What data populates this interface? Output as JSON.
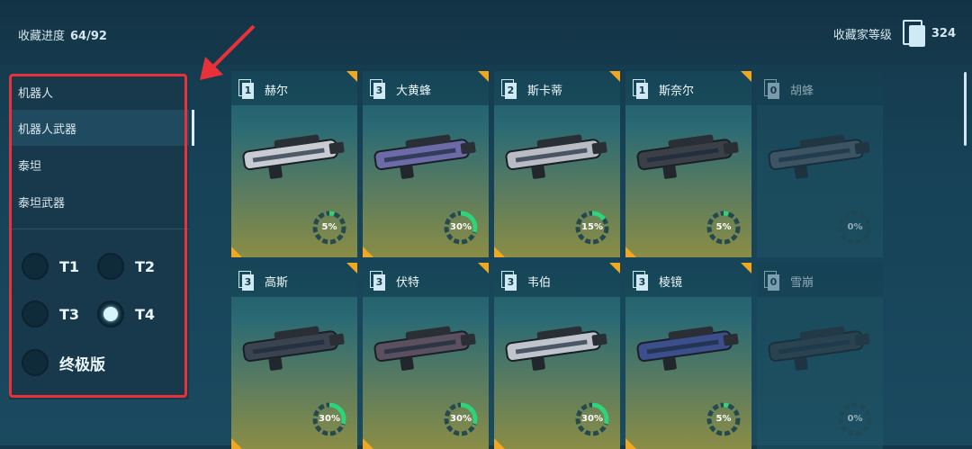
{
  "header": {
    "progress_label": "收藏进度",
    "progress_value": "64/92",
    "level_label": "收藏家等级",
    "level_value": "324"
  },
  "sidebar": {
    "categories": [
      {
        "label": "机器人",
        "active": false
      },
      {
        "label": "机器人武器",
        "active": true
      },
      {
        "label": "泰坦",
        "active": false
      },
      {
        "label": "泰坦武器",
        "active": false
      }
    ],
    "tiers": [
      {
        "label": "T1",
        "checked": false
      },
      {
        "label": "T2",
        "checked": false
      },
      {
        "label": "T3",
        "checked": false
      },
      {
        "label": "T4",
        "checked": true
      },
      {
        "label": "终极版",
        "checked": false
      }
    ]
  },
  "colors": {
    "accent": "#f2a81e",
    "progress": "#2fd47a",
    "highlight": "#e8323a"
  },
  "items": [
    {
      "name": "赫尔",
      "tier": "1",
      "progress": 5,
      "progress_label": "5%",
      "locked": false
    },
    {
      "name": "大黄蜂",
      "tier": "3",
      "progress": 30,
      "progress_label": "30%",
      "locked": false
    },
    {
      "name": "斯卡蒂",
      "tier": "2",
      "progress": 15,
      "progress_label": "15%",
      "locked": false
    },
    {
      "name": "斯奈尔",
      "tier": "1",
      "progress": 5,
      "progress_label": "5%",
      "locked": false
    },
    {
      "name": "胡蜂",
      "tier": "0",
      "progress": 0,
      "progress_label": "0%",
      "locked": true
    },
    {
      "name": "高斯",
      "tier": "3",
      "progress": 30,
      "progress_label": "30%",
      "locked": false
    },
    {
      "name": "伏特",
      "tier": "3",
      "progress": 30,
      "progress_label": "30%",
      "locked": false
    },
    {
      "name": "韦伯",
      "tier": "3",
      "progress": 30,
      "progress_label": "30%",
      "locked": false
    },
    {
      "name": "棱镜",
      "tier": "3",
      "progress": 5,
      "progress_label": "5%",
      "locked": false
    },
    {
      "name": "雪崩",
      "tier": "0",
      "progress": 0,
      "progress_label": "0%",
      "locked": true
    }
  ]
}
